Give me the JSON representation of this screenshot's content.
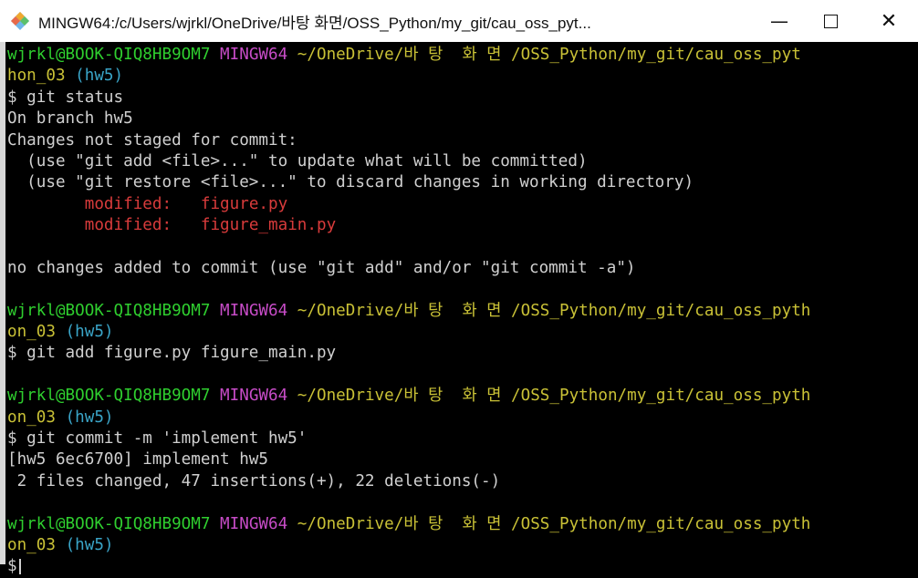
{
  "window": {
    "title": "MINGW64:/c/Users/wjrkl/OneDrive/바탕 화면/OSS_Python/my_git/cau_oss_pyt...",
    "minimize_glyph": "—",
    "close_glyph": "✕"
  },
  "terminal": {
    "prompt1": {
      "user": "wjrkl@BOOK-QIQ8HB9OM7",
      "shell": "MINGW64",
      "path_a": "~/OneDrive/바 탕  화 면 /OSS_Python/my_git/cau_oss_pyt",
      "path_b": "hon_03",
      "branch": "(hw5)",
      "command": "$ git status"
    },
    "status_output": {
      "on_branch": "On branch hw5",
      "changes_header": "Changes not staged for commit:",
      "hint_add": "  (use \"git add <file>...\" to update what will be committed)",
      "hint_restore": "  (use \"git restore <file>...\" to discard changes in working directory)",
      "modified_label": "modified:",
      "file1": "figure.py",
      "file2": "figure_main.py",
      "summary": "no changes added to commit (use \"git add\" and/or \"git commit -a\")"
    },
    "prompt2": {
      "user": "wjrkl@BOOK-QIQ8HB9OM7",
      "shell": "MINGW64",
      "path_a": "~/OneDrive/바 탕  화 면 /OSS_Python/my_git/cau_oss_pyth",
      "path_b": "on_03",
      "branch": "(hw5)",
      "command": "$ git add figure.py figure_main.py"
    },
    "prompt3": {
      "user": "wjrkl@BOOK-QIQ8HB9OM7",
      "shell": "MINGW64",
      "path_a": "~/OneDrive/바 탕  화 면 /OSS_Python/my_git/cau_oss_pyth",
      "path_b": "on_03",
      "branch": "(hw5)",
      "command": "$ git commit -m 'implement hw5'"
    },
    "commit_output": {
      "line1": "[hw5 6ec6700] implement hw5",
      "line2": " 2 files changed, 47 insertions(+), 22 deletions(-)"
    },
    "prompt4": {
      "user": "wjrkl@BOOK-QIQ8HB9OM7",
      "shell": "MINGW64",
      "path_a": "~/OneDrive/바 탕  화 면 /OSS_Python/my_git/cau_oss_pyth",
      "path_b": "on_03",
      "branch": "(hw5)",
      "command": "$"
    }
  },
  "colors": {
    "user": "#2fcf2f",
    "shell": "#c74cc7",
    "path": "#c9c136",
    "branch": "#3aa5c8",
    "modified": "#d83b3b",
    "text": "#d0d0d0",
    "background": "#000000"
  }
}
